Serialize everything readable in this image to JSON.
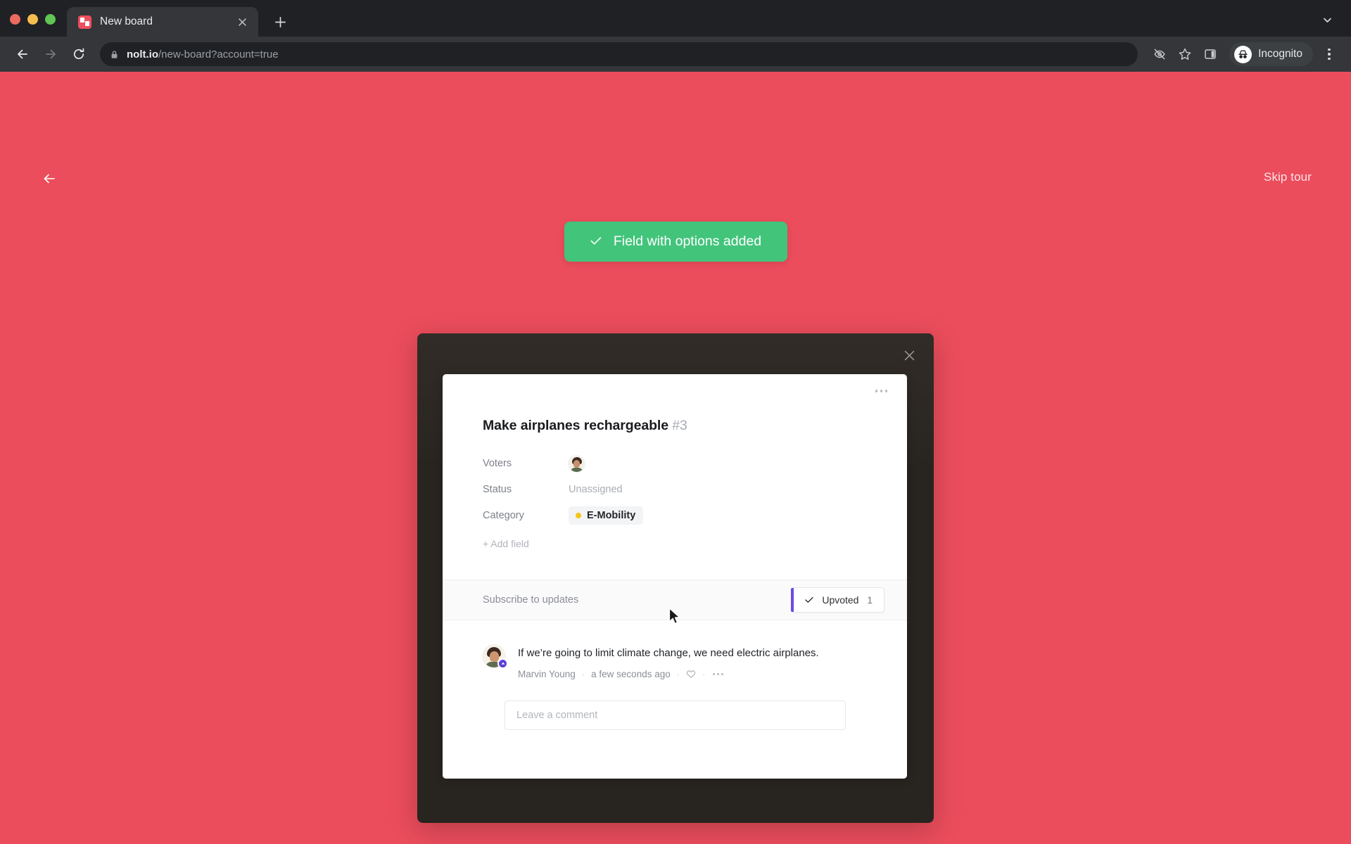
{
  "browser": {
    "tab": {
      "title": "New board",
      "favicon": "nolt-favicon",
      "close_icon": "close-icon"
    },
    "new_tab_icon": "plus-icon",
    "tab_list_icon": "chevron-down-icon",
    "nav": {
      "back_icon": "arrow-left-icon",
      "forward_icon": "arrow-right-icon",
      "reload_icon": "reload-icon"
    },
    "omnibox": {
      "lock_icon": "lock-icon",
      "url_domain": "nolt.io",
      "url_path": "/new-board?account=true"
    },
    "toolbar_icons": [
      "eye-off-icon",
      "star-icon",
      "side-panel-icon"
    ],
    "profile": {
      "label": "Incognito",
      "icon": "incognito-icon"
    },
    "menu_icon": "kebab-menu-icon"
  },
  "page": {
    "background_color": "#EB4D5C",
    "back_icon": "arrow-left-icon",
    "skip_tour_label": "Skip tour",
    "toast": {
      "check_icon": "check-icon",
      "message": "Field with options added",
      "color": "#42C47B"
    }
  },
  "modal": {
    "frame_color": "#282420",
    "close_icon": "close-icon",
    "card": {
      "more_icon": "more-horizontal-icon",
      "title": "Make airplanes rechargeable",
      "number": "#3",
      "fields": [
        {
          "label": "Voters",
          "type": "avatars",
          "value": ""
        },
        {
          "label": "Status",
          "type": "text",
          "value": "Unassigned"
        },
        {
          "label": "Category",
          "type": "chip",
          "value": "E-Mobility",
          "dot_color": "#F5C518"
        }
      ],
      "add_field_label": "+ Add field",
      "subscribe_label": "Subscribe to updates",
      "upvote": {
        "check_icon": "check-icon",
        "label": "Upvoted",
        "count": "1",
        "accent_color": "#6D4AE0"
      },
      "comment": {
        "text": "If we’re going to limit climate change, we need electric airplanes.",
        "author": "Marvin Young",
        "separator": "·",
        "timestamp": "a few seconds ago",
        "like_icon": "heart-icon",
        "more_icon": "more-horizontal-icon",
        "badge_icon": "upvote-badge-icon"
      },
      "comment_input_placeholder": "Leave a comment"
    }
  }
}
